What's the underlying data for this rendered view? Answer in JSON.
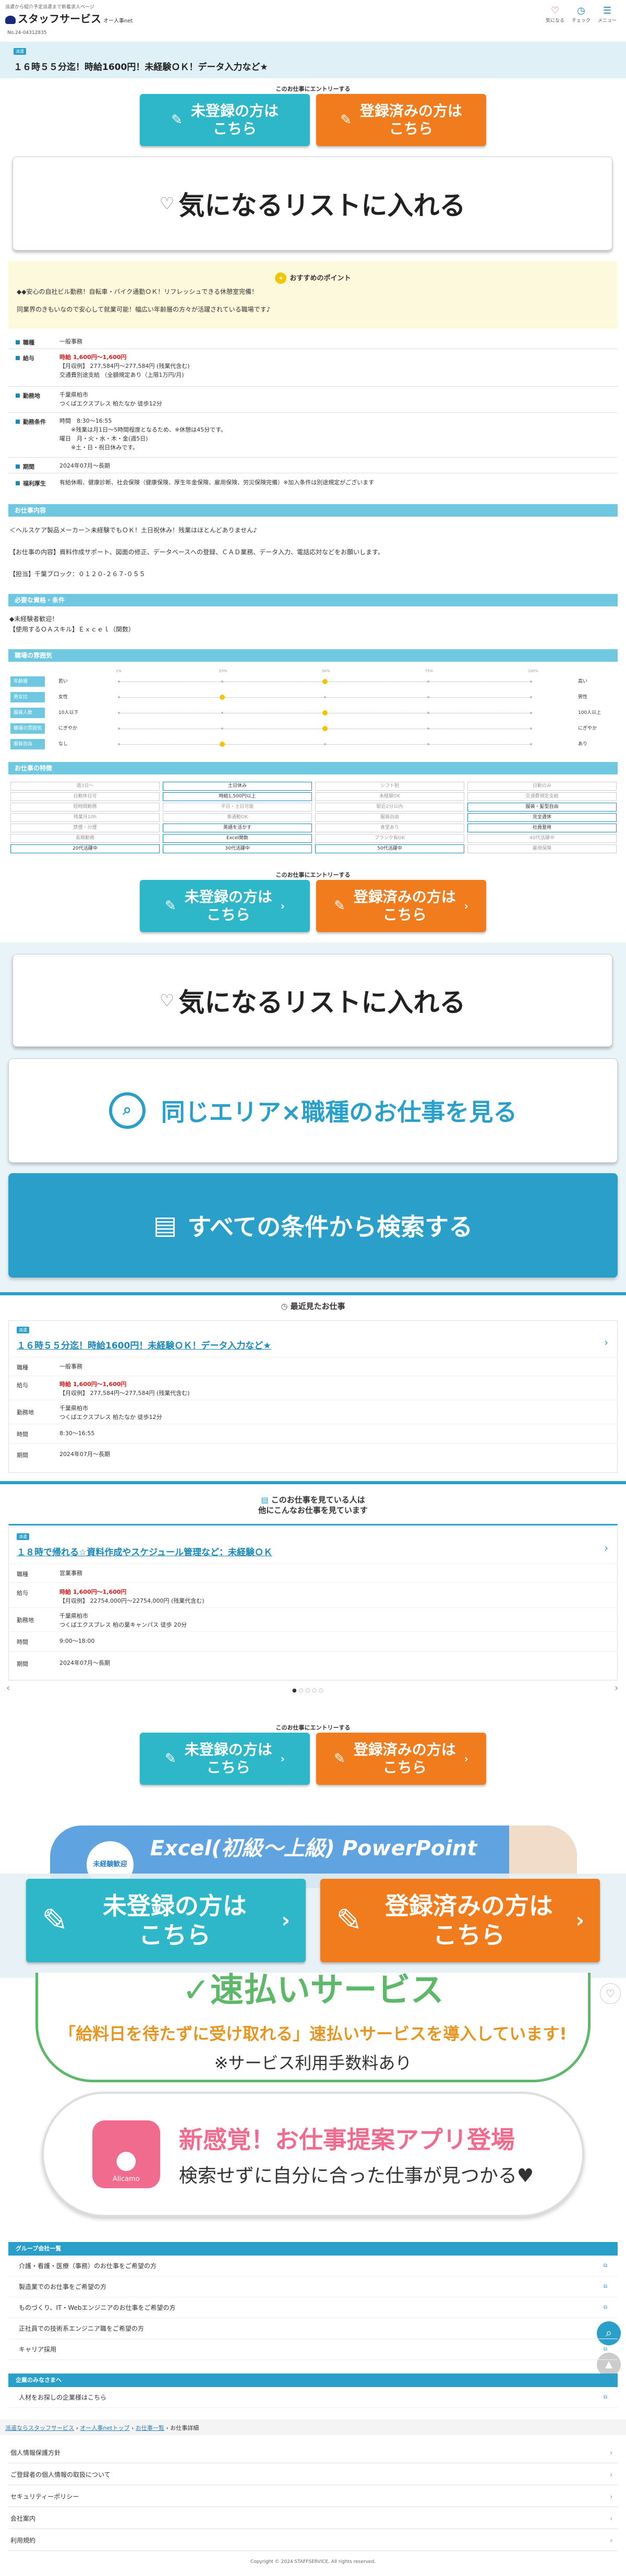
{
  "header": {
    "tagline": "派遣から紹介予定派遣まで新着求人ページ",
    "logo_text": "スタッフサービス",
    "logo_sub": "オー人事net",
    "icons": [
      {
        "icon": "heart-icon",
        "label": "気になる"
      },
      {
        "icon": "clock-icon",
        "label": "チェック"
      },
      {
        "icon": "menu-icon",
        "label": "メニュー"
      }
    ]
  },
  "job": {
    "number": "No.24-04312835",
    "tag": "派遣",
    "title": "１６時５５分迄！時給1600円！未経験ＯＫ！データ入力など★"
  },
  "entry": {
    "label": "このお仕事にエントリーする",
    "unregistered_l1": "未登録の方は",
    "unregistered_l2": "こちら",
    "registered_l1": "登録済みの方は",
    "registered_l2": "こちら"
  },
  "favorite_label": "気になるリストに入れる",
  "point": {
    "title": "おすすめのポイント",
    "line1": "◆◆安心の自社ビル勤務！自転車・バイク通勤ＯＫ！リフレッシュできる休憩室完備！",
    "line2": "同業界のきもいなので安心して就業可能！幅広い年齢層の方々が活躍されている職場です♪"
  },
  "info": {
    "category_label": "職種",
    "category_value": "一般事務",
    "wage_label": "給与",
    "wage_main": "時給 1,600円〜1,600円",
    "wage_sub1": "【月収例】 277,584円〜277,584円 (残業代含む)",
    "wage_sub2": "交通費別途支給 （全額規定あり（上限1万円/月)",
    "location_label": "勤務地",
    "location_l1": "千葉県柏市",
    "location_l2": "つくばエクスプレス 柏たなか 徒歩12分",
    "conditions_label": "勤務条件",
    "time_key": "時間",
    "time_l1": "8:30〜16:55",
    "time_l2": "※残業は月1日〜5時間程度となるため、※休憩は45分です。",
    "days_key": "曜日",
    "days_l1": "月・火・水・木・金(週5日)",
    "days_l2": "※土・日・祝日休みです。",
    "period_label": "期間",
    "period_value": "2024年07月〜長期",
    "welfare_label": "福利厚生",
    "welfare_value": "有給休暇、健康診断、社会保険（健康保険、厚生年金保険、雇用保険、労災保険完備）※加入条件は別途規定がございます"
  },
  "detail": {
    "title": "お仕事内容",
    "p1": "＜ヘルスケア製品メーカー＞未経験でもＯＫ！土日祝休み！残業はほとんどありません♪",
    "p2": "【お仕事の内容】資料作成サポート、図面の修正、データベースへの登録、ＣＡＤ業務、データ入力、電話応対などをお願いします。",
    "p3": "【担当】千葉ブロック：０１２０-２６７-０５５"
  },
  "skills": {
    "title": "必要な資格・条件",
    "l1": "◆未経験者歓迎！",
    "l2": "【使用するＯＡスキル】Ｅｘｃｅｌ（関数）"
  },
  "character": {
    "title": "職場の雰囲気",
    "ticks": [
      "1%",
      "25%",
      "50%",
      "75%",
      "100%"
    ],
    "rows": [
      {
        "label": "年齢層",
        "left": "若い",
        "right": "高い",
        "level": 0.5
      },
      {
        "label": "男女比",
        "left": "女性",
        "right": "男性",
        "level": 0.25
      },
      {
        "label": "服装人数",
        "left": "10人以下",
        "right": "100人以上",
        "level": 0.5
      },
      {
        "label": "職場の雰囲気",
        "left": "にぎやか",
        "right": "にぎやか",
        "level": 0.5
      },
      {
        "label": "服装自由",
        "left": "なし",
        "right": "あり",
        "level": 0.25
      }
    ]
  },
  "env": {
    "title": "お仕事の特徴",
    "cells": [
      [
        "週3日〜",
        "土日休み",
        "シフト制",
        "日勤のみ"
      ],
      [
        "日勤休日可",
        "時給1,500円以上",
        "未経験OK",
        "交通費規定支給"
      ],
      [
        "短時間勤務",
        "平日・土日可能",
        "駅近2分以内",
        "服装・髪型自由"
      ],
      [
        "残業月10h",
        "車通勤OK",
        "服装自由",
        "完全週休"
      ],
      [
        "禁煙・分煙",
        "英語を活かす",
        "食堂あり",
        "社員登用"
      ],
      [
        "長期勤務",
        "Excel関数",
        "ブランク有OK",
        "40代活躍中"
      ],
      [
        "20代活躍中",
        "30代活躍中",
        "50代活躍中",
        "雇用保険"
      ]
    ]
  },
  "search": {
    "same_area": "同じエリア×職種のお仕事を見る",
    "all_conditions": "すべての条件から検索する"
  },
  "recent": {
    "title": "最近見たお仕事",
    "tag": "派遣",
    "job_title": "１６時５５分迄！時給1600円！未経験ＯＫ！データ入力など★",
    "category_label": "職種",
    "category_value": "一般事務",
    "wage_label": "給与",
    "wage_main": "時給 1,600円〜1,600円",
    "wage_sub": "【月収例】 277,584円〜277,584円 (残業代含む)",
    "location_label": "勤務地",
    "location_l1": "千葉県柏市",
    "location_l2": "つくばエクスプレス 柏たなか 徒歩12分",
    "time_label": "時間",
    "time_value": "8:30〜16:55",
    "period_label": "期間",
    "period_value": "2024年07月〜長期"
  },
  "others": {
    "title_l1": "このお仕事を見ている人は",
    "title_l2": "他にこんなお仕事を見ています",
    "tag": "派遣",
    "job_title": "１８時で帰れる☆資料作成やスケジュール管理など：未経験ＯＫ",
    "category_label": "職種",
    "category_value": "営業事務",
    "wage_label": "給与",
    "wage_main": "時給 1,600円〜1,600円",
    "wage_sub": "【月収例】 22754,000円〜22754,000円 (残業代含む)",
    "location_label": "勤務地",
    "location_l1": "千葉県柏市",
    "location_l2": "つくばエクスプレス 柏の葉キャンパス 徒歩 20分",
    "time_label": "時間",
    "time_value": "9:00〜18:00",
    "period_label": "期間",
    "period_value": "2024年07月〜長期"
  },
  "banners": {
    "office_tag": "未経験歓迎",
    "office_text": "Excel(初級〜上級) PowerPoint",
    "pay_title": "速払いサービス",
    "pay_line1": "「給料日を待たずに受け取れる」速払いサービスを導入しています!",
    "pay_line2": "※サービス利用手数料あり",
    "app_name": "Alicamo",
    "app_line1": "新感覚！お仕事提案アプリ登場",
    "app_line2": "検索せずに自分に合った仕事が見つかる♥"
  },
  "group": {
    "title": "グループ会社一覧",
    "items": [
      "介護・看護・医療（事務）のお仕事をご希望の方",
      "製造業でのお仕事をご希望の方",
      "ものづくり、IT・Webエンジニアのお仕事をご希望の方",
      "正社員での技術系エンジニア職をご希望の方",
      "キャリア採用"
    ],
    "corp_title": "企業のみなさまへ",
    "corp_item": "人材をお探しの企業様はこちら"
  },
  "breadcrumb": [
    "派遣ならスタッフサービス",
    "オー人事netトップ",
    "お仕事一覧",
    "お仕事詳細"
  ],
  "footer": {
    "links": [
      "個人情報保護方針",
      "ご登録者の個人情報の取扱について",
      "セキュリティーポリシー",
      "会社案内",
      "利用規約"
    ],
    "copyright": "Copyright © 2024 STAFFSERVICE. All rights reserved."
  }
}
